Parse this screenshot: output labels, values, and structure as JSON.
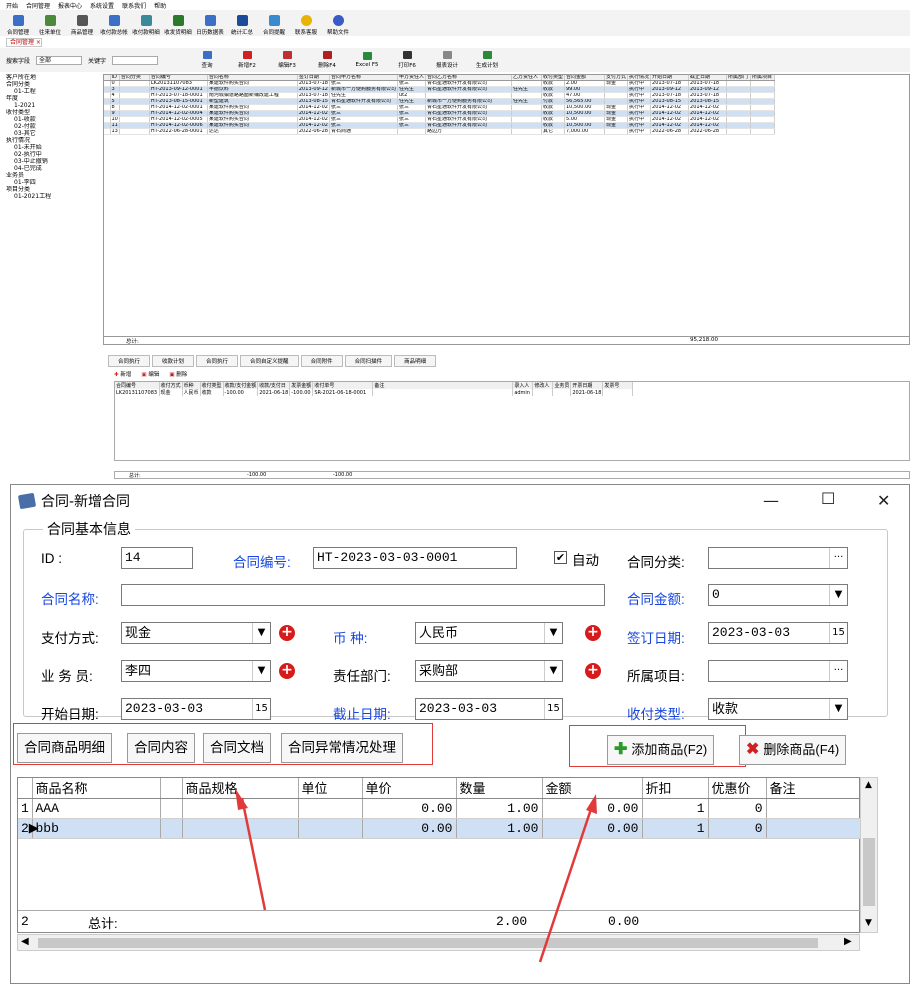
{
  "menubar": [
    "开始",
    "合同管理",
    "报表中心",
    "系统设置",
    "联系我们",
    "帮助"
  ],
  "toolbar": [
    "合同管理",
    "往来单位",
    "商品管理",
    "收付款总帐",
    "收付款明细",
    "收发货明细",
    "日历数据表",
    "统计汇总",
    "合同提醒",
    "联系客服",
    "帮助文件"
  ],
  "doc_tab": "合同管理 ×",
  "search": {
    "field_label": "搜索字段",
    "field_value": "全部",
    "keyword_label": "关键字",
    "buttons": [
      "查询",
      "新增F2",
      "编辑F3",
      "删除F4",
      "Excel F5",
      "打印F6",
      "报表设计",
      "生成计划"
    ]
  },
  "tree": [
    "客户所在地",
    "合同分类",
    "01-工程",
    "年度",
    "1-2021",
    "收付类型",
    "01-收款",
    "02-付款",
    "03-其它",
    "执行情况",
    "01-未开始",
    "02-执行中",
    "03-中止撤销",
    "04-已完成",
    "业务员",
    "01-李四",
    "项目分类",
    "01-2021工程"
  ],
  "grid": {
    "headers": [
      "ID",
      "合同分类",
      "合同编号",
      "合同名称",
      "签订日期",
      "合同甲方名称",
      "甲方责任人",
      "合同乙方名称",
      "乙方责任人",
      "收付类型",
      "合同金额",
      "支付方式",
      "执行情况",
      "开始日期",
      "截止日期",
      "所属部门",
      "所属项目"
    ],
    "rows": [
      [
        "0",
        "",
        "LK20131107083",
        "某建软件购买合同",
        "2013-07-18",
        "张三",
        "张三",
        "青石星通软件开发有限公司",
        "",
        "收款",
        "2.00",
        "现金",
        "执行中",
        "2013-07-18",
        "2013-07-18",
        "",
        ""
      ],
      [
        "3",
        "",
        "HT-2013-09-12-0001",
        "丰德饮料",
        "2013-09-12",
        "新城市一方便购服务有限公司",
        "任先生",
        "青石星通软件开发有限公司",
        "任先生",
        "收款",
        "99.00",
        "",
        "执行中",
        "2013-09-12",
        "2013-09-12",
        "",
        ""
      ],
      [
        "4",
        "",
        "HT-2013-07-18-0001",
        "南河城镇道路路面新铺改建工程",
        "2013-07-18",
        "任先生",
        "ut2",
        "",
        "",
        "收款",
        "47.00",
        "",
        "执行中",
        "2013-07-18",
        "2013-07-18",
        "",
        ""
      ],
      [
        "5",
        "",
        "HT-2013-08-15-0001",
        "新型建筑",
        "2013-08-15",
        "青石星通软件开发有限公司",
        "任先生",
        "新城市一方便购服务有限公司",
        "任先生",
        "付款",
        "56,565.00",
        "",
        "执行中",
        "2013-08-15",
        "2013-08-15",
        "",
        ""
      ],
      [
        "8",
        "",
        "HT-2014-12-02-0001",
        "某建软件购买合同",
        "2014-12-02",
        "张三",
        "张三",
        "青石星通软件开发有限公司",
        "",
        "收款",
        "10,500.00",
        "现金",
        "执行中",
        "2014-12-02",
        "2014-12-02",
        "",
        ""
      ],
      [
        "9",
        "",
        "HT-2014-12-02-0004",
        "某建软件购买合同",
        "2014-12-02",
        "张三",
        "张三",
        "青石星通软件开发有限公司",
        "",
        "收款",
        "10,500.00",
        "现金",
        "执行中",
        "2014-12-02",
        "2014-12-02",
        "",
        ""
      ],
      [
        "10",
        "",
        "HT-2014-12-02-0005",
        "某建软件购买合同",
        "2014-12-02",
        "张三",
        "张三",
        "青石星通软件开发有限公司",
        "",
        "收款",
        "5.00",
        "现金",
        "执行中",
        "2014-12-02",
        "2014-12-02",
        "",
        ""
      ],
      [
        "11",
        "",
        "HT-2014-12-02-0006",
        "某建软件购买合同",
        "2014-12-02",
        "张三",
        "张三",
        "青石星通软件开发有限公司",
        "",
        "收款",
        "10,500.00",
        "现金",
        "执行中",
        "2014-12-02",
        "2014-12-02",
        "",
        ""
      ],
      [
        "13",
        "",
        "HT-2022-06-28-0001",
        "达达",
        "2022-06-28",
        "青石商通",
        "",
        "路边方",
        "",
        "其它",
        "7,000.00",
        "",
        "执行中",
        "2022-06-28",
        "2022-06-28",
        "",
        ""
      ]
    ],
    "sum_label": "总计:",
    "sum_value": "95,218.00"
  },
  "bottom_tabs": [
    "合同执行",
    "收款计划",
    "合同执行",
    "合同自定义提醒",
    "合同附件",
    "合同扫描件",
    "商品明细"
  ],
  "bottom_actions": [
    "新增",
    "编辑",
    "删除"
  ],
  "sub": {
    "headers": [
      "合同编号",
      "收付方式",
      "币种",
      "收付类型",
      "收款/支付金额",
      "收款/支付日",
      "发票金额",
      "收付单号",
      "备注",
      "录入人",
      "修改人",
      "业务员",
      "开票日期",
      "发票号"
    ],
    "row": [
      "LK20131107083",
      "现金",
      "人民币",
      "收款",
      "-100.00",
      "2021-06-18",
      "-100.00",
      "SR-2021-06-18-0001",
      "",
      "admin",
      "",
      "",
      "2021-06-18",
      ""
    ],
    "sum_label": "总计:",
    "sum1": "-100.00",
    "sum2": "-100.00"
  },
  "dialog": {
    "title": "合同-新增合同",
    "group_title": "合同基本信息",
    "id_label": "ID    :",
    "id_value": "14",
    "code_label": "合同编号:",
    "code_value": "HT-2023-03-03-0001",
    "auto_label": "自动",
    "category_label": "合同分类:",
    "category_value": "",
    "name_label": "合同名称:",
    "name_value": "",
    "amount_label": "合同金额:",
    "amount_value": "0",
    "pay_label": "支付方式:",
    "pay_value": "现金",
    "currency_label": "币    种:",
    "currency_value": "人民币",
    "sign_label": "签订日期:",
    "sign_value": "2023-03-03",
    "sales_label": "业 务 员:",
    "sales_value": "李四",
    "dept_label": "责任部门:",
    "dept_value": "采购部",
    "project_label": "所属项目:",
    "project_value": "",
    "start_label": "开始日期:",
    "start_value": "2023-03-03",
    "end_label": "截止日期:",
    "end_value": "2023-03-03",
    "type_label": "收付类型:",
    "type_value": "收款",
    "tabs": [
      "合同商品明细",
      "合同内容",
      "合同文档",
      "合同异常情况处理"
    ],
    "add_label": "添加商品(F2)",
    "del_label": "删除商品(F4)",
    "grid_headers": [
      "",
      "商品名称",
      "",
      "商品规格",
      "单位",
      "单价",
      "数量",
      "金额",
      "折扣",
      "优惠价",
      "备注"
    ],
    "grid_rows": [
      [
        "1",
        "AAA",
        "",
        "",
        "",
        "0.00",
        "1.00",
        "0.00",
        "1",
        "0",
        ""
      ],
      [
        "2",
        "bbb",
        "",
        "",
        "",
        "0.00",
        "1.00",
        "0.00",
        "1",
        "0",
        ""
      ]
    ],
    "sum_index": "2",
    "sum_label": "总计:",
    "sum_qty": "2.00",
    "sum_amount": "0.00"
  },
  "colors": {
    "label_blue": "#1646e0",
    "highlight_red": "#e03a3a",
    "selected_row": "#cfe0f5"
  }
}
